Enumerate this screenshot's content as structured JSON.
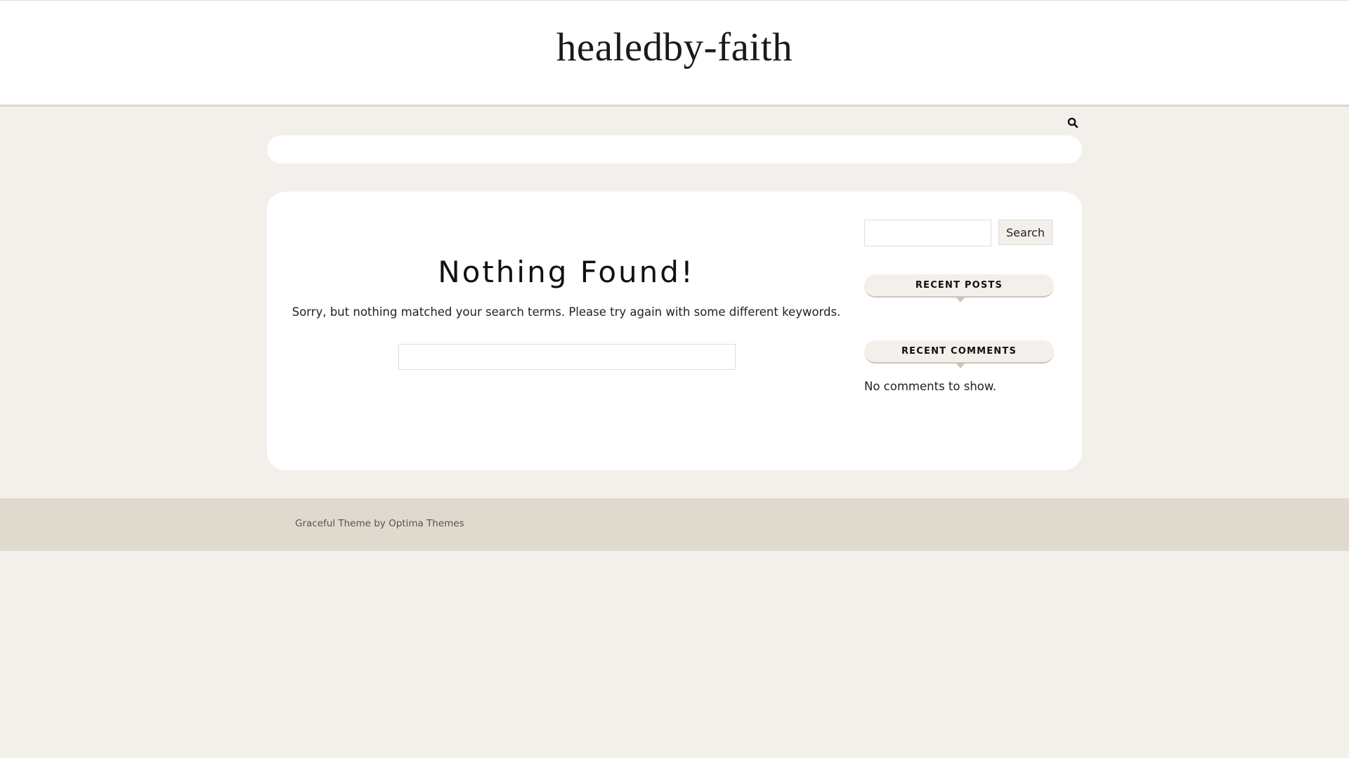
{
  "header": {
    "site_title": "healedby-faith"
  },
  "search_toggle": {
    "icon": "search-icon"
  },
  "main": {
    "heading": "Nothing Found!",
    "message": "Sorry, but nothing matched your search terms. Please try again with some different keywords.",
    "search_placeholder": ""
  },
  "sidebar": {
    "search_placeholder": "",
    "search_button_label": "Search",
    "recent_posts_title": "RECENT POSTS",
    "recent_comments_title": "RECENT COMMENTS",
    "no_comments_text": "No comments to show."
  },
  "footer": {
    "theme_name": "Graceful Theme",
    "by_text": "by",
    "author": "Optima Themes"
  },
  "colors": {
    "page_background": "#f3f0eb",
    "card_background": "#ffffff",
    "footer_background": "#e0d9cd",
    "accent_border": "#cfc5b5"
  }
}
